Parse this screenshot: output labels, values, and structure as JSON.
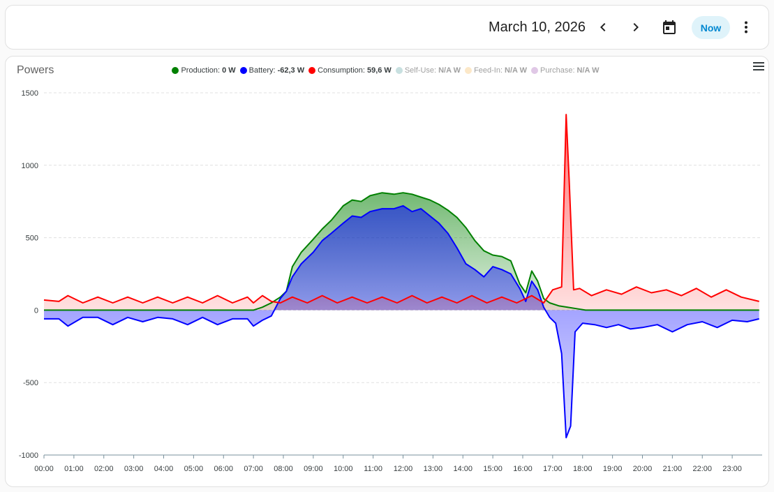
{
  "header": {
    "date": "March 10, 2026",
    "now_label": "Now",
    "icons": [
      "chevron-left-icon",
      "chevron-right-icon",
      "calendar-icon",
      "more-vertical-icon"
    ]
  },
  "chart_title": "Powers",
  "legend": [
    {
      "name": "Production",
      "value": "0 W",
      "color": "#008000",
      "active": true
    },
    {
      "name": "Battery",
      "value": "-62,3 W",
      "color": "#0000ff",
      "active": true
    },
    {
      "name": "Consumption",
      "value": "59,6 W",
      "color": "#ff0000",
      "active": true
    },
    {
      "name": "Self-Use",
      "value": "N/A W",
      "color": "#c8e0e0",
      "active": false
    },
    {
      "name": "Feed-In",
      "value": "N/A W",
      "color": "#fce8c8",
      "active": false
    },
    {
      "name": "Purchase",
      "value": "N/A W",
      "color": "#e0c8e6",
      "active": false
    }
  ],
  "chart_data": {
    "type": "area",
    "title": "Powers",
    "xlabel": "",
    "ylabel": "",
    "xlim": [
      0,
      24
    ],
    "ylim": [
      -1000,
      1500
    ],
    "yticks": [
      1500,
      1000,
      500,
      0,
      -500,
      -1000
    ],
    "xticks": [
      "00:00",
      "01:00",
      "02:00",
      "03:00",
      "04:00",
      "05:00",
      "06:00",
      "07:00",
      "08:00",
      "09:00",
      "10:00",
      "11:00",
      "12:00",
      "13:00",
      "14:00",
      "15:00",
      "16:00",
      "17:00",
      "18:00",
      "19:00",
      "20:00",
      "21:00",
      "22:00",
      "23:00"
    ],
    "grid": true,
    "legend_position": "top",
    "series": [
      {
        "name": "Production",
        "color": "#008000",
        "x": [
          0,
          7.0,
          7.3,
          7.6,
          7.9,
          8.1,
          8.3,
          8.6,
          9.0,
          9.3,
          9.6,
          10.0,
          10.3,
          10.6,
          10.9,
          11.3,
          11.7,
          12.0,
          12.3,
          12.6,
          12.9,
          13.2,
          13.5,
          13.8,
          14.1,
          14.4,
          14.7,
          15.0,
          15.3,
          15.6,
          15.9,
          16.1,
          16.3,
          16.5,
          16.7,
          16.9,
          17.2,
          17.5,
          17.8,
          18.1,
          18.4,
          23.9
        ],
        "y": [
          0,
          0,
          20,
          50,
          90,
          130,
          300,
          400,
          490,
          560,
          620,
          720,
          760,
          750,
          790,
          810,
          800,
          810,
          800,
          780,
          760,
          730,
          690,
          640,
          570,
          480,
          410,
          380,
          370,
          340,
          180,
          120,
          270,
          200,
          80,
          50,
          30,
          20,
          10,
          0,
          0,
          0
        ]
      },
      {
        "name": "Battery",
        "color": "#0000ff",
        "x": [
          0,
          0.5,
          0.8,
          1.3,
          1.8,
          2.3,
          2.8,
          3.3,
          3.8,
          4.3,
          4.8,
          5.3,
          5.8,
          6.3,
          6.8,
          7.0,
          7.3,
          7.6,
          7.9,
          8.1,
          8.3,
          8.6,
          9.0,
          9.3,
          9.6,
          10.0,
          10.3,
          10.6,
          10.9,
          11.3,
          11.7,
          12.0,
          12.3,
          12.6,
          12.9,
          13.2,
          13.5,
          13.8,
          14.1,
          14.4,
          14.7,
          15.0,
          15.3,
          15.6,
          15.9,
          16.1,
          16.3,
          16.5,
          16.7,
          16.9,
          17.1,
          17.3,
          17.45,
          17.6,
          17.75,
          18.0,
          18.4,
          18.8,
          19.2,
          19.6,
          20.0,
          20.5,
          21.0,
          21.5,
          22.0,
          22.5,
          23.0,
          23.5,
          23.9
        ],
        "y": [
          -60,
          -60,
          -110,
          -50,
          -50,
          -100,
          -50,
          -80,
          -50,
          -60,
          -100,
          -50,
          -100,
          -60,
          -60,
          -110,
          -70,
          -40,
          80,
          130,
          230,
          320,
          400,
          480,
          530,
          600,
          650,
          640,
          680,
          700,
          700,
          720,
          680,
          700,
          650,
          600,
          530,
          430,
          320,
          280,
          230,
          300,
          280,
          250,
          150,
          60,
          200,
          140,
          20,
          -50,
          -90,
          -300,
          -880,
          -800,
          -150,
          -90,
          -100,
          -120,
          -100,
          -130,
          -120,
          -100,
          -150,
          -100,
          -80,
          -120,
          -70,
          -80,
          -60
        ]
      },
      {
        "name": "Consumption",
        "color": "#ff0000",
        "x": [
          0,
          0.5,
          0.8,
          1.3,
          1.8,
          2.3,
          2.8,
          3.3,
          3.8,
          4.3,
          4.8,
          5.3,
          5.8,
          6.3,
          6.8,
          7.0,
          7.3,
          7.6,
          7.9,
          8.3,
          8.8,
          9.3,
          9.8,
          10.3,
          10.8,
          11.3,
          11.8,
          12.3,
          12.8,
          13.3,
          13.8,
          14.3,
          14.8,
          15.3,
          15.8,
          16.3,
          16.7,
          17.0,
          17.3,
          17.45,
          17.55,
          17.7,
          17.9,
          18.3,
          18.8,
          19.3,
          19.8,
          20.3,
          20.8,
          21.3,
          21.8,
          22.3,
          22.8,
          23.3,
          23.9
        ],
        "y": [
          70,
          60,
          100,
          50,
          90,
          50,
          90,
          50,
          90,
          50,
          90,
          50,
          100,
          50,
          90,
          50,
          100,
          60,
          50,
          90,
          50,
          100,
          50,
          90,
          50,
          90,
          50,
          100,
          50,
          90,
          50,
          100,
          50,
          90,
          50,
          100,
          50,
          140,
          160,
          1350,
          900,
          140,
          150,
          100,
          140,
          110,
          160,
          120,
          140,
          100,
          150,
          90,
          140,
          90,
          60
        ]
      }
    ]
  }
}
